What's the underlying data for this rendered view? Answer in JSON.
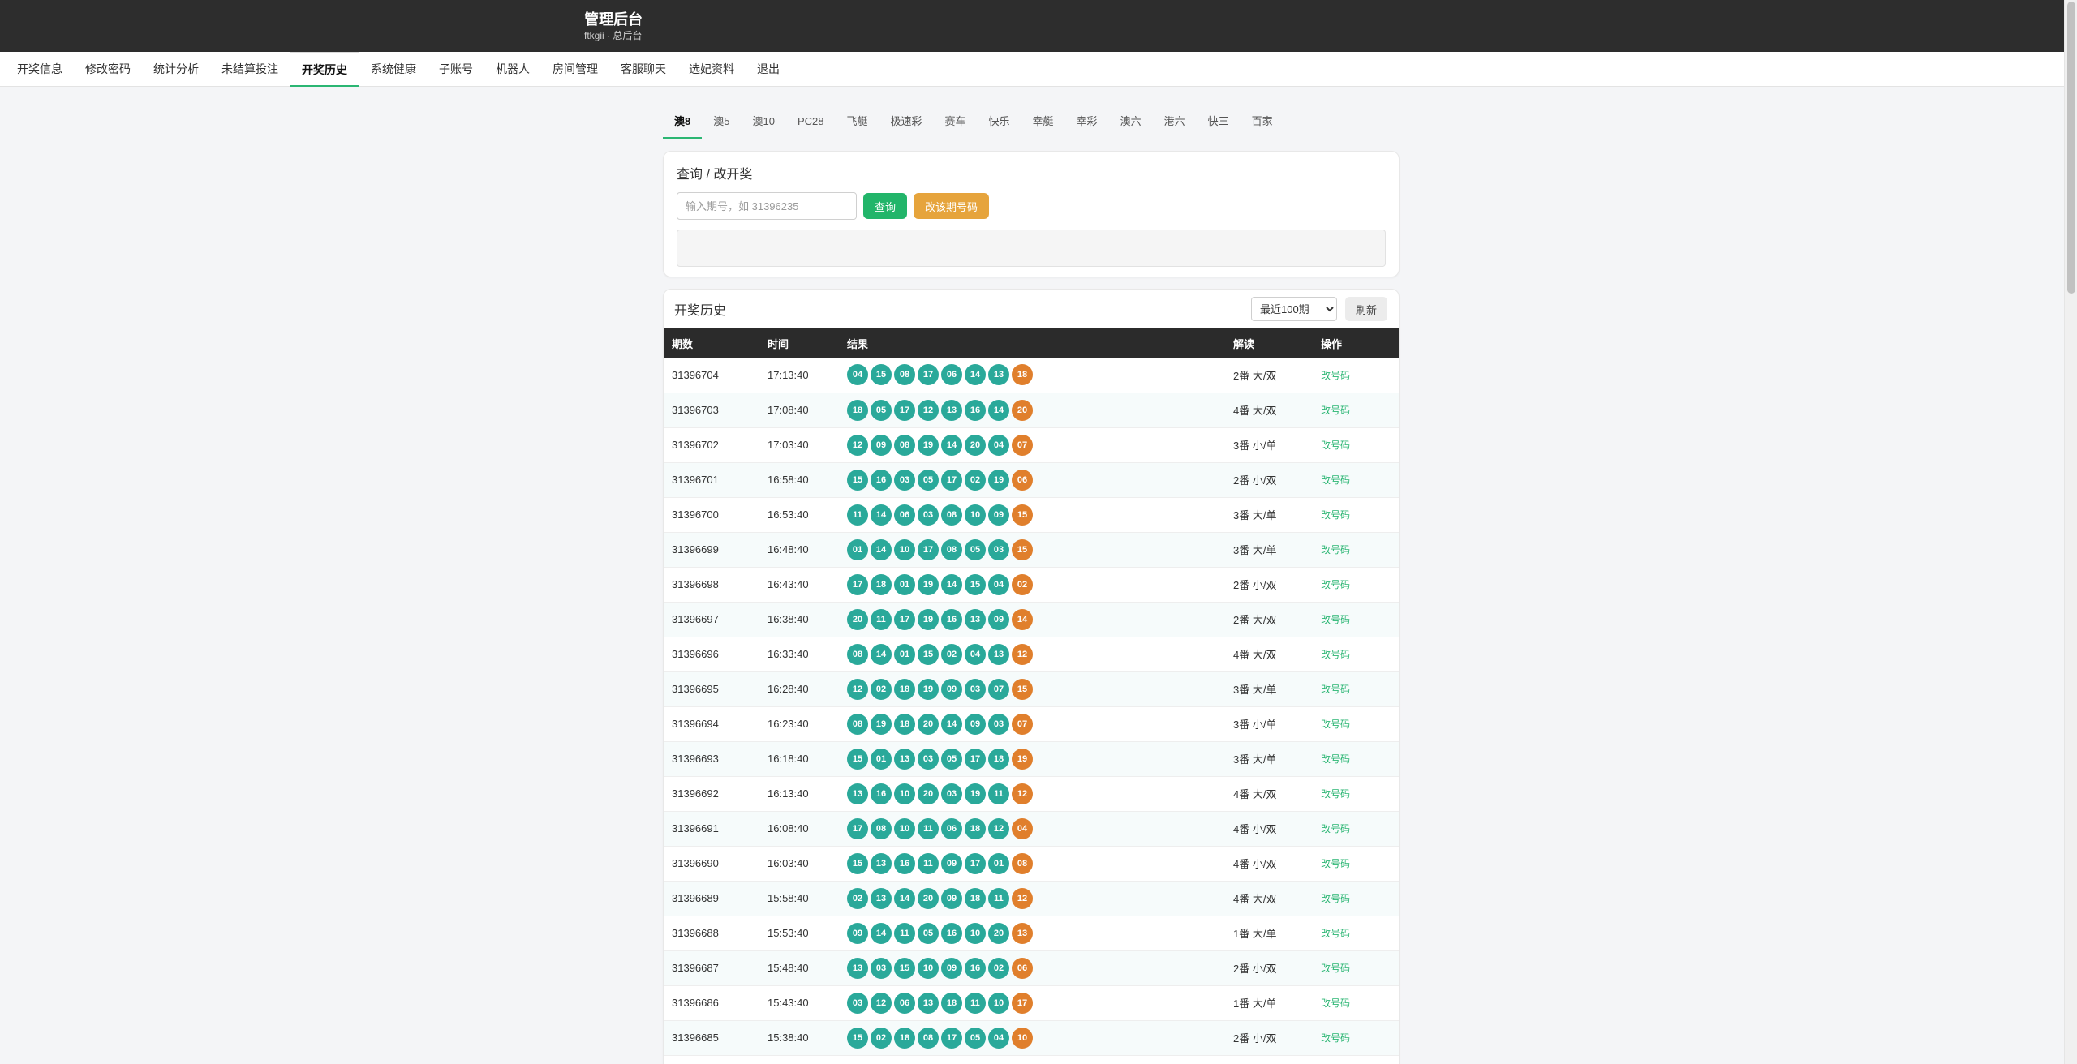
{
  "header": {
    "title": "管理后台",
    "subtitle": "ftkgii · 总后台"
  },
  "nav": {
    "items": [
      "开奖信息",
      "修改密码",
      "统计分析",
      "未结算投注",
      "开奖历史",
      "系统健康",
      "子账号",
      "机器人",
      "房间管理",
      "客服聊天",
      "选妃资料",
      "退出"
    ],
    "active": "开奖历史"
  },
  "game_tabs": {
    "items": [
      "澳8",
      "澳5",
      "澳10",
      "PC28",
      "飞艇",
      "极速彩",
      "赛车",
      "快乐",
      "幸艇",
      "幸彩",
      "澳六",
      "港六",
      "快三",
      "百家"
    ],
    "active": "澳8"
  },
  "query": {
    "title": "查询 / 改开奖",
    "placeholder": "输入期号，如 31396235",
    "query_button": "查询",
    "change_button": "改该期号码"
  },
  "history": {
    "title": "开奖历史",
    "select_value": "最近100期",
    "refresh_button": "刷新",
    "columns": [
      "期数",
      "时间",
      "结果",
      "解读",
      "操作"
    ],
    "action_label": "改号码",
    "rows": [
      {
        "period": "31396704",
        "time": "17:13:40",
        "balls": [
          "04",
          "15",
          "08",
          "17",
          "06",
          "14",
          "13",
          "18"
        ],
        "reading": "2番 大/双"
      },
      {
        "period": "31396703",
        "time": "17:08:40",
        "balls": [
          "18",
          "05",
          "17",
          "12",
          "13",
          "16",
          "14",
          "20"
        ],
        "reading": "4番 大/双"
      },
      {
        "period": "31396702",
        "time": "17:03:40",
        "balls": [
          "12",
          "09",
          "08",
          "19",
          "14",
          "20",
          "04",
          "07"
        ],
        "reading": "3番 小/单"
      },
      {
        "period": "31396701",
        "time": "16:58:40",
        "balls": [
          "15",
          "16",
          "03",
          "05",
          "17",
          "02",
          "19",
          "06"
        ],
        "reading": "2番 小/双"
      },
      {
        "period": "31396700",
        "time": "16:53:40",
        "balls": [
          "11",
          "14",
          "06",
          "03",
          "08",
          "10",
          "09",
          "15"
        ],
        "reading": "3番 大/单"
      },
      {
        "period": "31396699",
        "time": "16:48:40",
        "balls": [
          "01",
          "14",
          "10",
          "17",
          "08",
          "05",
          "03",
          "15"
        ],
        "reading": "3番 大/单"
      },
      {
        "period": "31396698",
        "time": "16:43:40",
        "balls": [
          "17",
          "18",
          "01",
          "19",
          "14",
          "15",
          "04",
          "02"
        ],
        "reading": "2番 小/双"
      },
      {
        "period": "31396697",
        "time": "16:38:40",
        "balls": [
          "20",
          "11",
          "17",
          "19",
          "16",
          "13",
          "09",
          "14"
        ],
        "reading": "2番 大/双"
      },
      {
        "period": "31396696",
        "time": "16:33:40",
        "balls": [
          "08",
          "14",
          "01",
          "15",
          "02",
          "04",
          "13",
          "12"
        ],
        "reading": "4番 大/双"
      },
      {
        "period": "31396695",
        "time": "16:28:40",
        "balls": [
          "12",
          "02",
          "18",
          "19",
          "09",
          "03",
          "07",
          "15"
        ],
        "reading": "3番 大/单"
      },
      {
        "period": "31396694",
        "time": "16:23:40",
        "balls": [
          "08",
          "19",
          "18",
          "20",
          "14",
          "09",
          "03",
          "07"
        ],
        "reading": "3番 小/单"
      },
      {
        "period": "31396693",
        "time": "16:18:40",
        "balls": [
          "15",
          "01",
          "13",
          "03",
          "05",
          "17",
          "18",
          "19"
        ],
        "reading": "3番 大/单"
      },
      {
        "period": "31396692",
        "time": "16:13:40",
        "balls": [
          "13",
          "16",
          "10",
          "20",
          "03",
          "19",
          "11",
          "12"
        ],
        "reading": "4番 大/双"
      },
      {
        "period": "31396691",
        "time": "16:08:40",
        "balls": [
          "17",
          "08",
          "10",
          "11",
          "06",
          "18",
          "12",
          "04"
        ],
        "reading": "4番 小/双"
      },
      {
        "period": "31396690",
        "time": "16:03:40",
        "balls": [
          "15",
          "13",
          "16",
          "11",
          "09",
          "17",
          "01",
          "08"
        ],
        "reading": "4番 小/双"
      },
      {
        "period": "31396689",
        "time": "15:58:40",
        "balls": [
          "02",
          "13",
          "14",
          "20",
          "09",
          "18",
          "11",
          "12"
        ],
        "reading": "4番 大/双"
      },
      {
        "period": "31396688",
        "time": "15:53:40",
        "balls": [
          "09",
          "14",
          "11",
          "05",
          "16",
          "10",
          "20",
          "13"
        ],
        "reading": "1番 大/单"
      },
      {
        "period": "31396687",
        "time": "15:48:40",
        "balls": [
          "13",
          "03",
          "15",
          "10",
          "09",
          "16",
          "02",
          "06"
        ],
        "reading": "2番 小/双"
      },
      {
        "period": "31396686",
        "time": "15:43:40",
        "balls": [
          "03",
          "12",
          "06",
          "13",
          "18",
          "11",
          "10",
          "17"
        ],
        "reading": "1番 大/单"
      },
      {
        "period": "31396685",
        "time": "15:38:40",
        "balls": [
          "15",
          "02",
          "18",
          "08",
          "17",
          "05",
          "04",
          "10"
        ],
        "reading": "2番 小/双"
      }
    ]
  }
}
